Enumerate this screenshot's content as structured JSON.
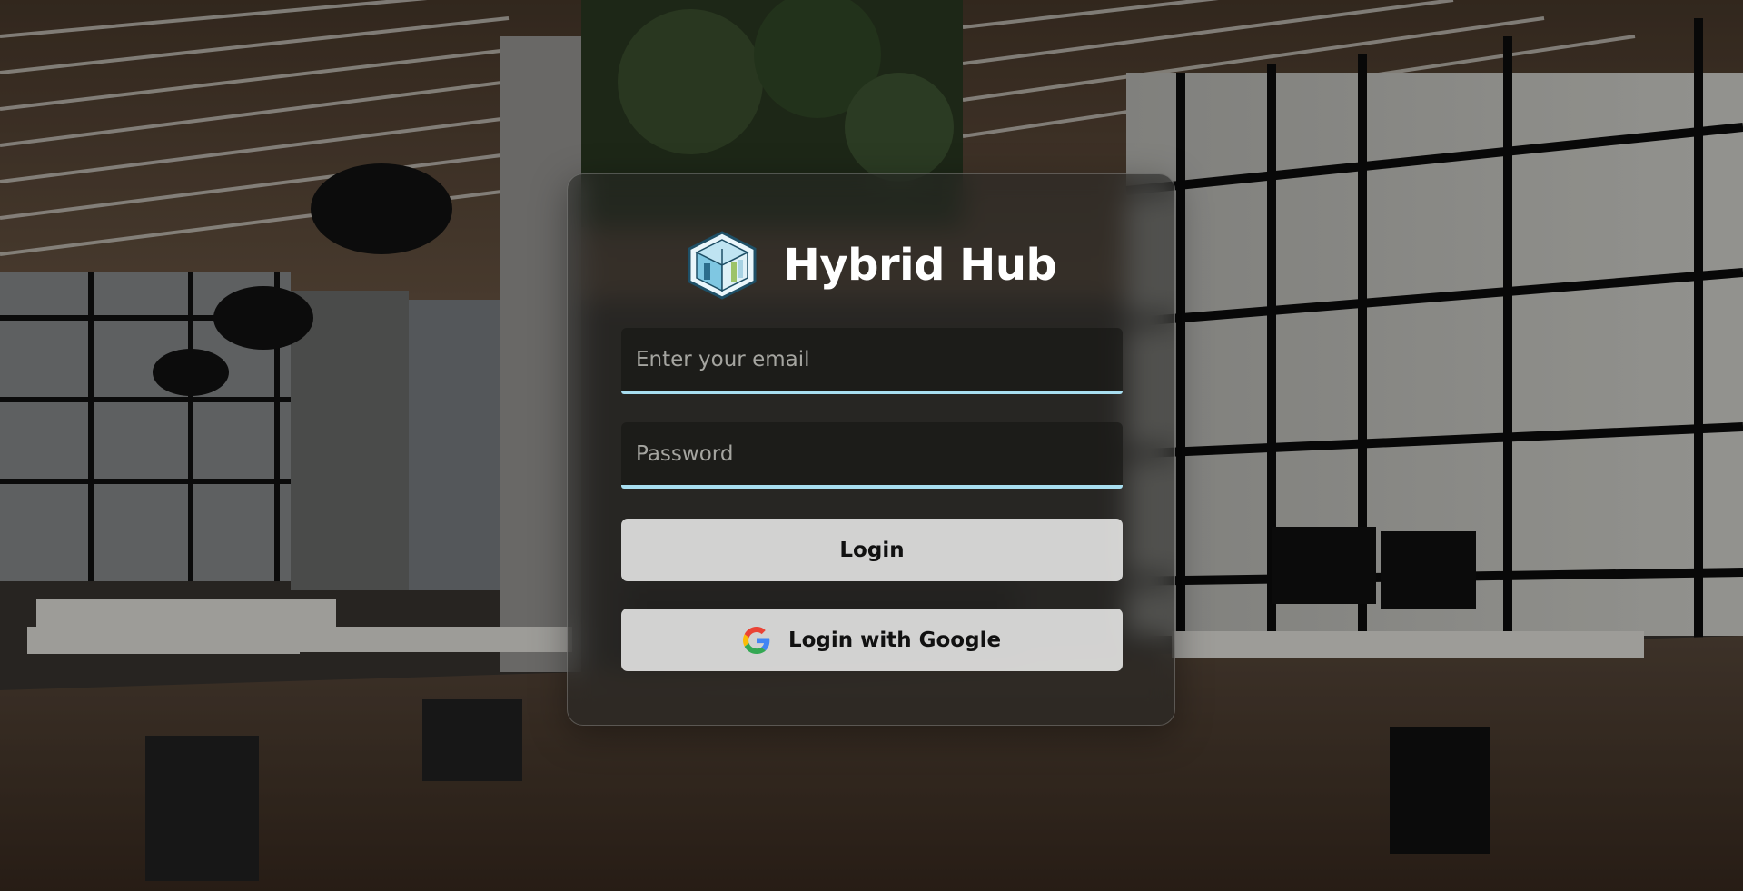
{
  "brand": {
    "title": "Hybrid Hub",
    "logo_icon": "hybrid-hub-logo-icon"
  },
  "form": {
    "email_placeholder": "Enter your email",
    "password_placeholder": "Password",
    "login_label": "Login",
    "google_label": "Login with Google",
    "google_icon": "google-icon"
  },
  "colors": {
    "field_underline": "#a8def0",
    "button_bg": "#e6e6e4",
    "button_text": "#111111",
    "title_text": "#ffffff"
  }
}
